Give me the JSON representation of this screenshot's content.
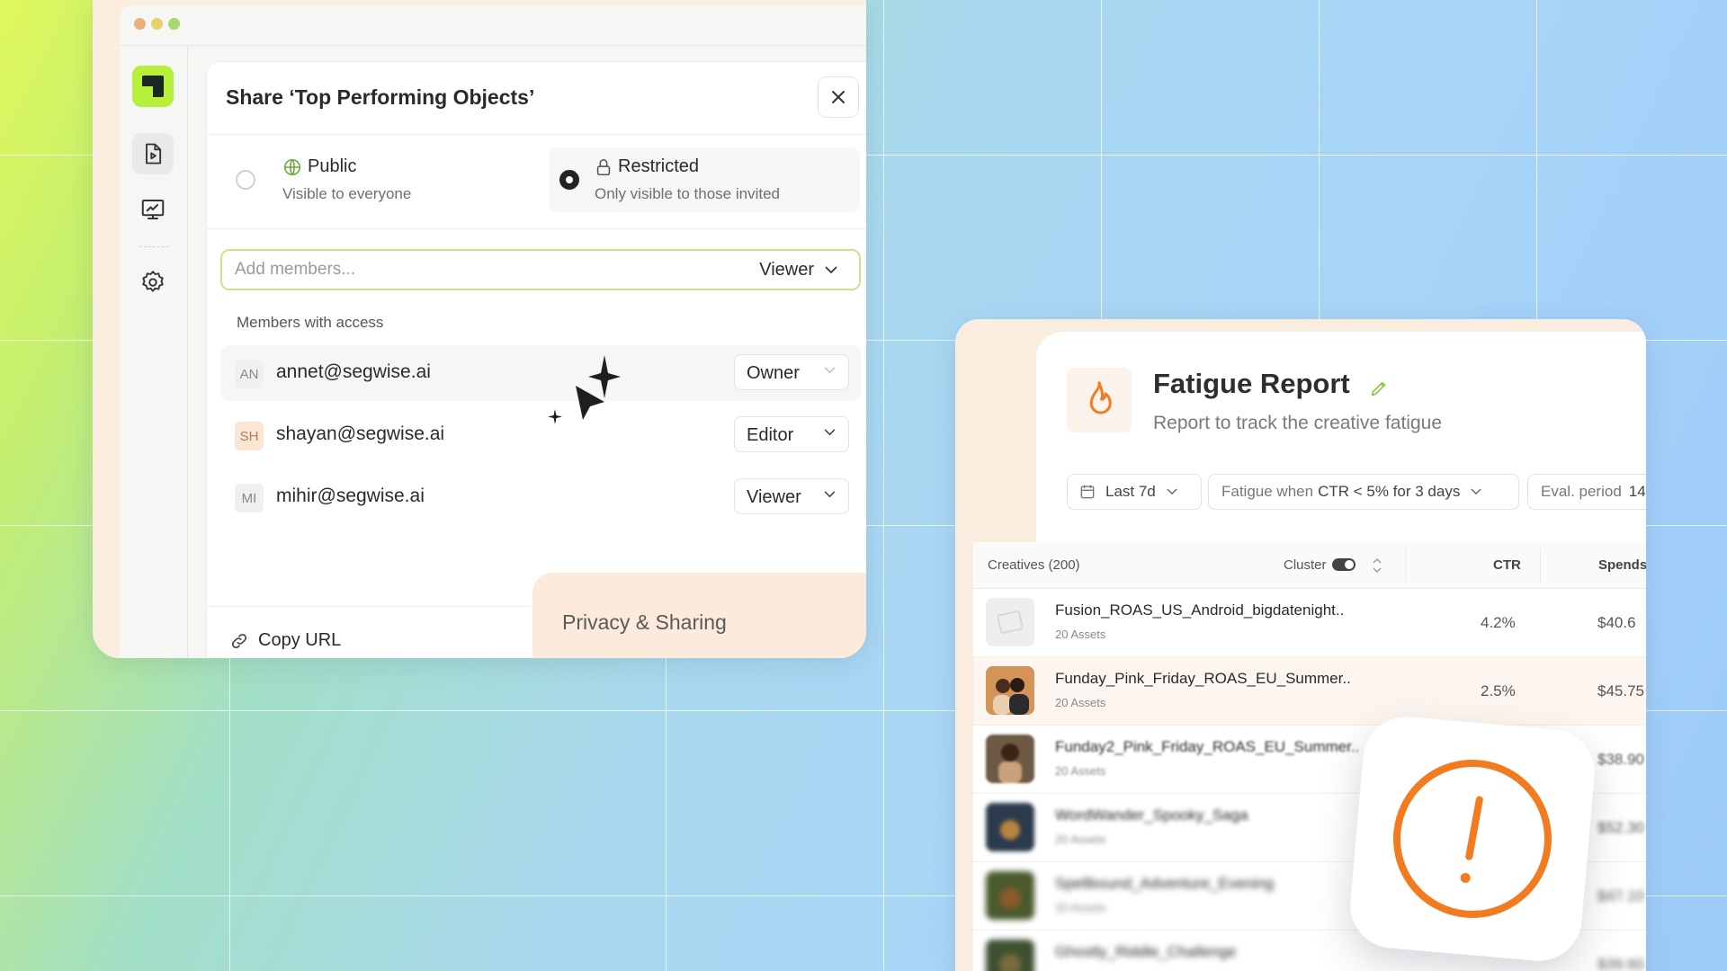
{
  "share_dialog": {
    "title": "Share ‘Top Performing Objects’",
    "visibility_options": [
      {
        "label": "Public",
        "description": "Visible to everyone",
        "selected": false,
        "icon": "globe-icon"
      },
      {
        "label": "Restricted",
        "description": "Only visible to those invited",
        "selected": true,
        "icon": "lock-icon"
      }
    ],
    "add_members": {
      "placeholder": "Add members...",
      "value": "",
      "role": "Viewer"
    },
    "members_heading": "Members with access",
    "members": [
      {
        "initials": "AN",
        "email": "annet@segwise.ai",
        "role": "Owner"
      },
      {
        "initials": "SH",
        "email": "shayan@segwise.ai",
        "role": "Editor"
      },
      {
        "initials": "MI",
        "email": "mihir@segwise.ai",
        "role": "Viewer"
      }
    ],
    "copy_url_label": "Copy URL",
    "privacy_tab_label": "Privacy & Sharing"
  },
  "sidebar": {
    "icons": [
      "video-report-icon",
      "trend-chart-icon",
      "settings-gear-icon"
    ]
  },
  "report": {
    "title": "Fatigue Report",
    "subtitle": "Report to track the creative fatigue",
    "filters": {
      "date": "Last 7d",
      "fatigue_prefix": "Fatigue when ",
      "fatigue_condition": "CTR < 5% for 3 days",
      "eval_period_label": "Eval. period",
      "eval_period_value": "14"
    },
    "table": {
      "headers": {
        "creatives": "Creatives (200)",
        "cluster": "Cluster",
        "ctr": "CTR",
        "spends": "Spends"
      },
      "rows": [
        {
          "name": "Fusion_ROAS_US_Android_bigdatenight..",
          "assets": "20 Assets",
          "ctr": "4.2%",
          "spend": "$40.6"
        },
        {
          "name": "Funday_Pink_Friday_ROAS_EU_Summer..",
          "assets": "20 Assets",
          "ctr": "2.5%",
          "spend": "$45.75"
        },
        {
          "name": "Funday2_Pink_Friday_ROAS_EU_Summer..",
          "assets": "20 Assets",
          "ctr": "",
          "spend": "$38.90"
        },
        {
          "name": "WordWander_Spooky_Saga",
          "assets": "20 Assets",
          "ctr": "",
          "spend": "$52.30"
        },
        {
          "name": "Spellbound_Adventure_Evening",
          "assets": "20 Assets",
          "ctr": "",
          "spend": "$47.10"
        },
        {
          "name": "Ghostly_Riddle_Challenge",
          "assets": "",
          "ctr": "",
          "spend": "$39.60"
        }
      ]
    }
  },
  "warning_badge": {
    "icon": "alert-circle-icon"
  },
  "colors": {
    "accent_green": "#b6f03a",
    "alert_orange": "#f27b1f",
    "logo_dark": "#1c2721"
  }
}
